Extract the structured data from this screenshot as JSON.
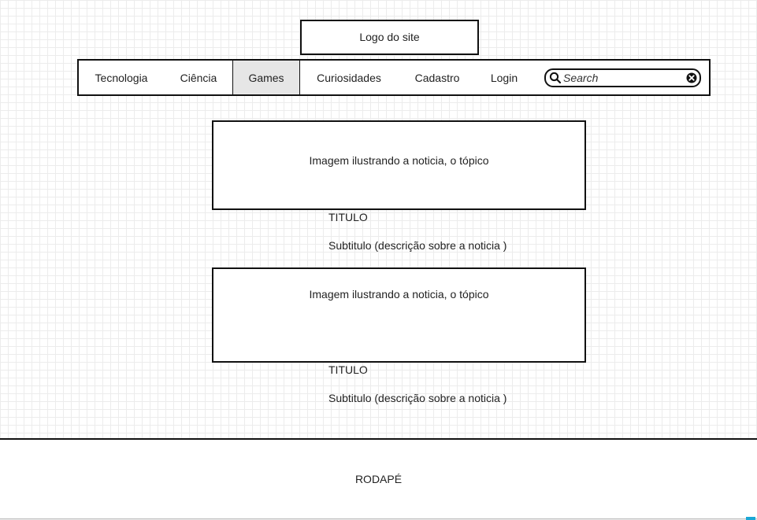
{
  "header": {
    "logo_text": "Logo do site"
  },
  "nav": {
    "items": [
      {
        "label": "Tecnologia",
        "active": false
      },
      {
        "label": "Ciência",
        "active": false
      },
      {
        "label": "Games",
        "active": true
      },
      {
        "label": "Curiosidades",
        "active": false
      },
      {
        "label": "Cadastro",
        "active": false
      },
      {
        "label": "Login",
        "active": false
      }
    ],
    "search": {
      "placeholder": "Search",
      "value": "",
      "icon": "search-icon",
      "clear_icon": "close-icon"
    }
  },
  "news": [
    {
      "image_text": "Imagem ilustrando a noticia, o tópico",
      "title": "TITULO",
      "subtitle": "Subtitulo (descrição sobre a noticia )"
    },
    {
      "image_text": "Imagem ilustrando a noticia, o tópico",
      "title": "TITULO",
      "subtitle": "Subtitulo (descrição sobre a noticia )"
    }
  ],
  "footer": {
    "text": "RODAPÉ"
  },
  "colors": {
    "border": "#111111",
    "active_tab": "#e6e6e6",
    "grid": "#ececec",
    "accent": "#1aa7d6"
  }
}
